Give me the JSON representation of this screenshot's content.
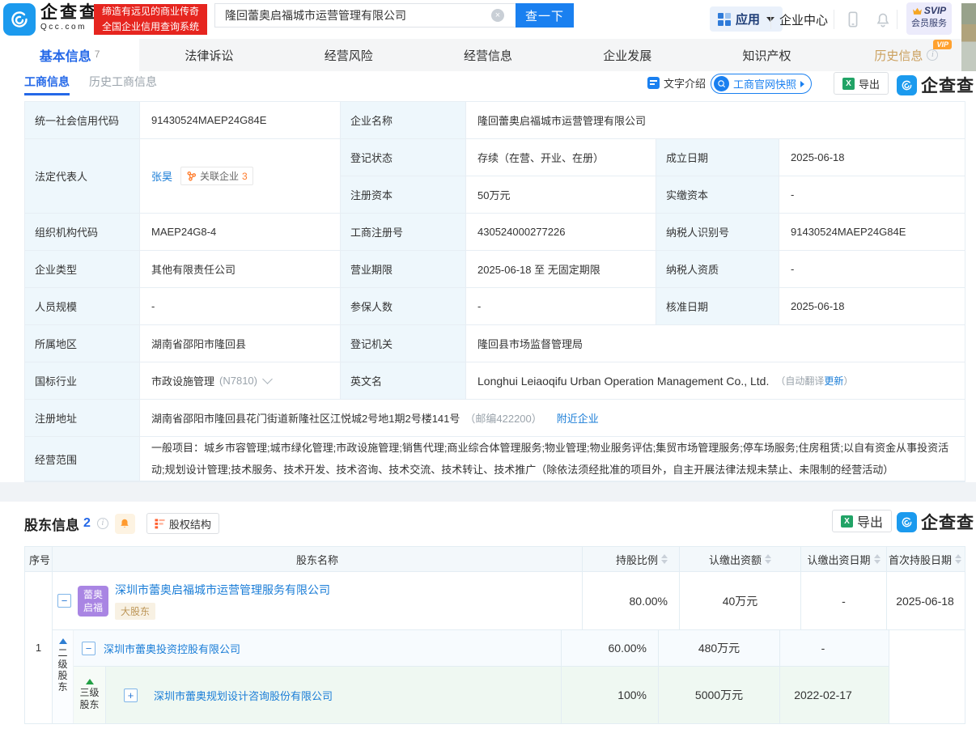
{
  "colors": {
    "brand_blue": "#1b9aee",
    "button_blue": "#1a80f0",
    "link_blue": "#1a7dd7",
    "banner_red": "#e6251f",
    "vip_orange": "#ffa12f",
    "avatar_purple": "#a985e3",
    "label_cell_bg": "#eef7fc",
    "level3_row_green": "#eff8f2"
  },
  "brand": {
    "name": "企查查",
    "domain": "Qcc.com",
    "slogan_line1": "缔造有远见的商业传奇",
    "slogan_line2": "全国企业信用查询系统"
  },
  "topbar": {
    "search_value": "隆回蕾奥启福城市运营管理有限公司",
    "search_button": "查一下",
    "apps": "应用",
    "enterprise_center": "企业中心",
    "svip_title": "SVIP",
    "svip_sub": "会员服务"
  },
  "nav": {
    "tabs": [
      {
        "label": "基本信息",
        "count": "7"
      },
      {
        "label": "法律诉讼"
      },
      {
        "label": "经营风险"
      },
      {
        "label": "经营信息"
      },
      {
        "label": "企业发展"
      },
      {
        "label": "知识产权"
      },
      {
        "label": "历史信息",
        "vip": "VIP"
      }
    ]
  },
  "subnav": {
    "tab_active": "工商信息",
    "tab_plain": "历史工商信息",
    "text_intro": "文字介绍",
    "snapshot": "工商官网快照",
    "export": "导出",
    "logo": "企查查"
  },
  "info": {
    "credit_code_label": "统一社会信用代码",
    "credit_code": "91430524MAEP24G84E",
    "name_label": "企业名称",
    "name": "隆回蕾奥启福城市运营管理有限公司",
    "legal_rep_label": "法定代表人",
    "legal_rep": "张昊",
    "related_label": "关联企业",
    "related_count": "3",
    "status_label": "登记状态",
    "status": "存续（在营、开业、在册）",
    "est_date_label": "成立日期",
    "est_date": "2025-06-18",
    "reg_capital_label": "注册资本",
    "reg_capital": "50万元",
    "paid_capital_label": "实缴资本",
    "paid_capital": "-",
    "org_code_label": "组织机构代码",
    "org_code": "MAEP24G8-4",
    "reg_no_label": "工商注册号",
    "reg_no": "430524000277226",
    "taxpayer_id_label": "纳税人识别号",
    "taxpayer_id": "91430524MAEP24G84E",
    "company_type_label": "企业类型",
    "company_type": "其他有限责任公司",
    "biz_term_label": "营业期限",
    "biz_term": "2025-06-18 至 无固定期限",
    "taxpayer_quality_label": "纳税人资质",
    "taxpayer_quality": "-",
    "staff_size_label": "人员规模",
    "staff_size": "-",
    "insured_label": "参保人数",
    "insured": "-",
    "approval_date_label": "核准日期",
    "approval_date": "2025-06-18",
    "area_label": "所属地区",
    "area": "湖南省邵阳市隆回县",
    "authority_label": "登记机关",
    "authority": "隆回县市场监督管理局",
    "industry_label": "国标行业",
    "industry": "市政设施管理",
    "industry_code": "(N7810)",
    "en_name_label": "英文名",
    "en_name": "Longhui Leiaoqifu Urban Operation Management Co., Ltd.",
    "en_note_prefix": "（自动翻译",
    "en_update": "更新",
    "en_note_suffix": "）",
    "address_label": "注册地址",
    "address": "湖南省邵阳市隆回县花门街道新隆社区江悦城2号地1期2号楼141号",
    "address_zip": "（邮编422200）",
    "nearby": "附近企业",
    "scope_label": "经营范围",
    "scope": "一般项目：城乡市容管理;城市绿化管理;市政设施管理;销售代理;商业综合体管理服务;物业管理;物业服务评估;集贸市场管理服务;停车场服务;住房租赁;以自有资金从事投资活动;规划设计管理;技术服务、技术开发、技术咨询、技术交流、技术转让、技术推广（除依法须经批准的项目外，自主开展法律法规未禁止、未限制的经营活动）"
  },
  "shareholders": {
    "title": "股东信息",
    "count": "2",
    "equity_btn": "股权结构",
    "export": "导出",
    "logo": "企查查",
    "columns": {
      "seq": "序号",
      "name": "股东名称",
      "ratio": "持股比例",
      "amount": "认缴出资额",
      "pay_date": "认缴出资日期",
      "first_date": "首次持股日期"
    },
    "seq": "1",
    "level2_label": "二级股东",
    "level3_label": "三级股东",
    "rows": [
      {
        "name": "深圳市蕾奥启福城市运营管理服务有限公司",
        "avatar_line1": "蕾奥",
        "avatar_line2": "启福",
        "badge": "大股东",
        "ratio": "80.00%",
        "amount": "40万元",
        "pay_date": "-",
        "first_date": "2025-06-18"
      },
      {
        "name": "深圳市蕾奥投资控股有限公司",
        "ratio": "60.00%",
        "amount": "480万元",
        "pay_date": "-"
      },
      {
        "name": "深圳市蕾奥规划设计咨询股份有限公司",
        "ratio": "100%",
        "amount": "5000万元",
        "pay_date": "2022-02-17"
      }
    ]
  }
}
